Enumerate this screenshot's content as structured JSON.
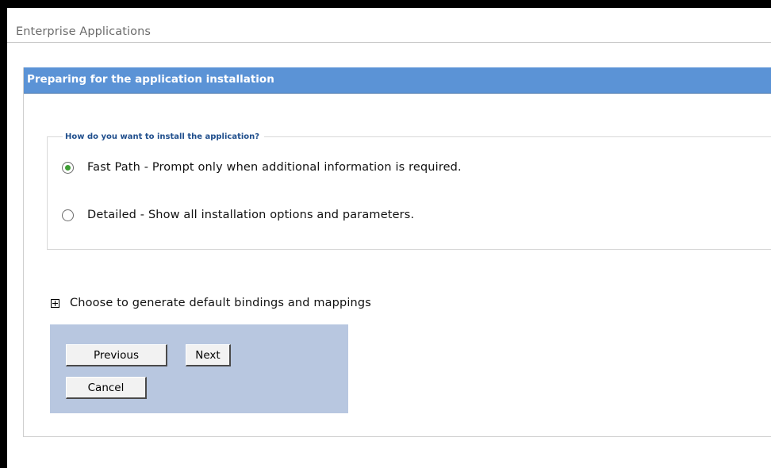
{
  "page": {
    "title": "Enterprise Applications"
  },
  "panel": {
    "header": "Preparing for the application installation"
  },
  "install_options": {
    "legend": "How do you want to install the application?",
    "options": [
      {
        "label": "Fast Path - Prompt only when additional information is required.",
        "selected": true
      },
      {
        "label": "Detailed - Show all installation options and parameters.",
        "selected": false
      }
    ]
  },
  "bindings": {
    "label": "Choose to generate default bindings and mappings",
    "expanded": false
  },
  "buttons": {
    "previous": "Previous",
    "next": "Next",
    "cancel": "Cancel"
  },
  "colors": {
    "header_bg": "#5b93d6",
    "button_area_bg": "#b8c7e0",
    "legend_text": "#1f4e8c",
    "radio_selected": "#3f9e35"
  }
}
